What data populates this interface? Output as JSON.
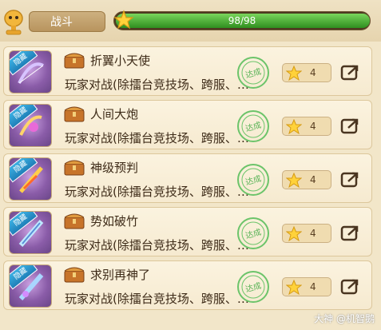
{
  "header": {
    "tab_label": "战斗",
    "progress_text": "98/98",
    "progress_fraction": 1.0
  },
  "achievements": [
    {
      "title": "折翼小天使",
      "desc": "玩家对战(除擂台竞技场、跨服、…",
      "ribbon": "隐藏",
      "stamp": "达成",
      "reward": "4"
    },
    {
      "title": "人间大炮",
      "desc": "玩家对战(除擂台竞技场、跨服、…",
      "ribbon": "隐藏",
      "stamp": "达成",
      "reward": "4"
    },
    {
      "title": "神级预判",
      "desc": "玩家对战(除擂台竞技场、跨服、…",
      "ribbon": "隐藏",
      "stamp": "达成",
      "reward": "4"
    },
    {
      "title": "势如破竹",
      "desc": "玩家对战(除擂台竞技场、跨服、…",
      "ribbon": "隐藏",
      "stamp": "达成",
      "reward": "4"
    },
    {
      "title": "求别再神了",
      "desc": "玩家对战(除擂台竞技场、跨服、…",
      "ribbon": "隐藏",
      "stamp": "达成",
      "reward": "4"
    }
  ],
  "icons": {
    "header_icon": "trophy-icon",
    "item_chest": "treasure-chest-icon",
    "reward": "star-icon",
    "goto": "external-link-icon"
  },
  "watermark": "大神 @机智鹅"
}
